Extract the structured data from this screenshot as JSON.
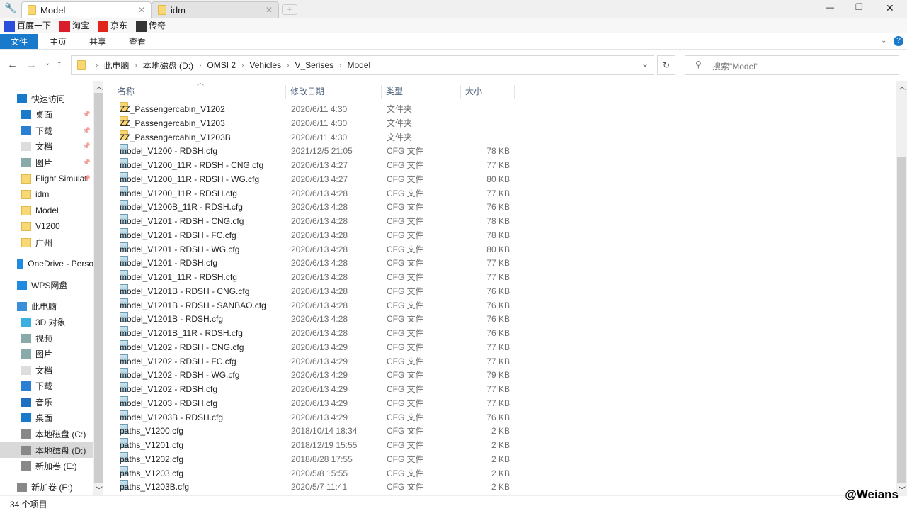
{
  "tabs": [
    {
      "label": "Model",
      "active": true
    },
    {
      "label": "idm",
      "active": false
    }
  ],
  "bookmarks": [
    {
      "label": "百度一下",
      "color": "#2b4fd8"
    },
    {
      "label": "淘宝",
      "color": "#d81e2b"
    },
    {
      "label": "京东",
      "color": "#e1251b"
    },
    {
      "label": "传奇",
      "color": "#333"
    }
  ],
  "ribbon": [
    "文件",
    "主页",
    "共享",
    "查看"
  ],
  "breadcrumb": [
    "此电脑",
    "本地磁盘 (D:)",
    "OMSI 2",
    "Vehicles",
    "V_Serises",
    "Model"
  ],
  "search_placeholder": "搜索\"Model\"",
  "sidebar": [
    {
      "label": "快速访问",
      "icon": "star-icon",
      "indent": 0
    },
    {
      "label": "桌面",
      "icon": "desktop-icon",
      "indent": 1,
      "pin": true
    },
    {
      "label": "下载",
      "icon": "download-icon",
      "indent": 1,
      "pin": true
    },
    {
      "label": "文档",
      "icon": "document-icon",
      "indent": 1,
      "pin": true
    },
    {
      "label": "图片",
      "icon": "picture-icon",
      "indent": 1,
      "pin": true
    },
    {
      "label": "Flight Simulat",
      "icon": "folder-icon",
      "indent": 1,
      "pin": true
    },
    {
      "label": "idm",
      "icon": "folder-icon",
      "indent": 1
    },
    {
      "label": "Model",
      "icon": "folder-icon",
      "indent": 1
    },
    {
      "label": "V1200",
      "icon": "folder-icon",
      "indent": 1
    },
    {
      "label": "广州",
      "icon": "folder-icon",
      "indent": 1
    },
    {
      "label": "OneDrive - Perso",
      "icon": "cloud-icon",
      "indent": 0
    },
    {
      "label": "WPS网盘",
      "icon": "cloud-icon",
      "indent": 0
    },
    {
      "label": "此电脑",
      "icon": "computer-icon",
      "indent": 0
    },
    {
      "label": "3D 对象",
      "icon": "cube-icon",
      "indent": 1
    },
    {
      "label": "视频",
      "icon": "video-icon",
      "indent": 1
    },
    {
      "label": "图片",
      "icon": "picture-icon",
      "indent": 1
    },
    {
      "label": "文档",
      "icon": "document-icon",
      "indent": 1
    },
    {
      "label": "下载",
      "icon": "download-icon",
      "indent": 1
    },
    {
      "label": "音乐",
      "icon": "music-icon",
      "indent": 1
    },
    {
      "label": "桌面",
      "icon": "desktop-icon",
      "indent": 1
    },
    {
      "label": "本地磁盘 (C:)",
      "icon": "drive-icon",
      "indent": 1
    },
    {
      "label": "本地磁盘 (D:)",
      "icon": "drive-icon",
      "indent": 1,
      "selected": true
    },
    {
      "label": "新加卷 (E:)",
      "icon": "drive-icon",
      "indent": 1
    },
    {
      "label": "新加卷 (E:)",
      "icon": "drive-icon",
      "indent": 0
    }
  ],
  "columns": [
    "名称",
    "修改日期",
    "类型",
    "大小"
  ],
  "files": [
    [
      "ZZ_Passengercabin_V1202",
      "2020/6/11 4:30",
      "文件夹",
      ""
    ],
    [
      "ZZ_Passengercabin_V1203",
      "2020/6/11 4:30",
      "文件夹",
      ""
    ],
    [
      "ZZ_Passengercabin_V1203B",
      "2020/6/11 4:30",
      "文件夹",
      ""
    ],
    [
      "model_V1200 - RDSH.cfg",
      "2021/12/5 21:05",
      "CFG 文件",
      "78 KB"
    ],
    [
      "model_V1200_11R - RDSH - CNG.cfg",
      "2020/6/13 4:27",
      "CFG 文件",
      "77 KB"
    ],
    [
      "model_V1200_11R - RDSH - WG.cfg",
      "2020/6/13 4:27",
      "CFG 文件",
      "80 KB"
    ],
    [
      "model_V1200_11R - RDSH.cfg",
      "2020/6/13 4:28",
      "CFG 文件",
      "77 KB"
    ],
    [
      "model_V1200B_11R - RDSH.cfg",
      "2020/6/13 4:28",
      "CFG 文件",
      "76 KB"
    ],
    [
      "model_V1201 - RDSH - CNG.cfg",
      "2020/6/13 4:28",
      "CFG 文件",
      "78 KB"
    ],
    [
      "model_V1201 - RDSH - FC.cfg",
      "2020/6/13 4:28",
      "CFG 文件",
      "78 KB"
    ],
    [
      "model_V1201 - RDSH - WG.cfg",
      "2020/6/13 4:28",
      "CFG 文件",
      "80 KB"
    ],
    [
      "model_V1201 - RDSH.cfg",
      "2020/6/13 4:28",
      "CFG 文件",
      "77 KB"
    ],
    [
      "model_V1201_11R - RDSH.cfg",
      "2020/6/13 4:28",
      "CFG 文件",
      "77 KB"
    ],
    [
      "model_V1201B - RDSH - CNG.cfg",
      "2020/6/13 4:28",
      "CFG 文件",
      "76 KB"
    ],
    [
      "model_V1201B - RDSH - SANBAO.cfg",
      "2020/6/13 4:28",
      "CFG 文件",
      "76 KB"
    ],
    [
      "model_V1201B - RDSH.cfg",
      "2020/6/13 4:28",
      "CFG 文件",
      "76 KB"
    ],
    [
      "model_V1201B_11R - RDSH.cfg",
      "2020/6/13 4:28",
      "CFG 文件",
      "76 KB"
    ],
    [
      "model_V1202 - RDSH - CNG.cfg",
      "2020/6/13 4:29",
      "CFG 文件",
      "77 KB"
    ],
    [
      "model_V1202 - RDSH - FC.cfg",
      "2020/6/13 4:29",
      "CFG 文件",
      "77 KB"
    ],
    [
      "model_V1202 - RDSH - WG.cfg",
      "2020/6/13 4:29",
      "CFG 文件",
      "79 KB"
    ],
    [
      "model_V1202 - RDSH.cfg",
      "2020/6/13 4:29",
      "CFG 文件",
      "77 KB"
    ],
    [
      "model_V1203 - RDSH.cfg",
      "2020/6/13 4:29",
      "CFG 文件",
      "77 KB"
    ],
    [
      "model_V1203B - RDSH.cfg",
      "2020/6/13 4:29",
      "CFG 文件",
      "76 KB"
    ],
    [
      "paths_V1200.cfg",
      "2018/10/14 18:34",
      "CFG 文件",
      "2 KB"
    ],
    [
      "paths_V1201.cfg",
      "2018/12/19 15:55",
      "CFG 文件",
      "2 KB"
    ],
    [
      "paths_V1202.cfg",
      "2018/8/28 17:55",
      "CFG 文件",
      "2 KB"
    ],
    [
      "paths_V1203.cfg",
      "2020/5/8 15:55",
      "CFG 文件",
      "2 KB"
    ],
    [
      "paths_V1203B.cfg",
      "2020/5/7 11:41",
      "CFG 文件",
      "2 KB"
    ]
  ],
  "status": "34 个项目",
  "watermark": "@Weians",
  "accent": "#1979ca"
}
